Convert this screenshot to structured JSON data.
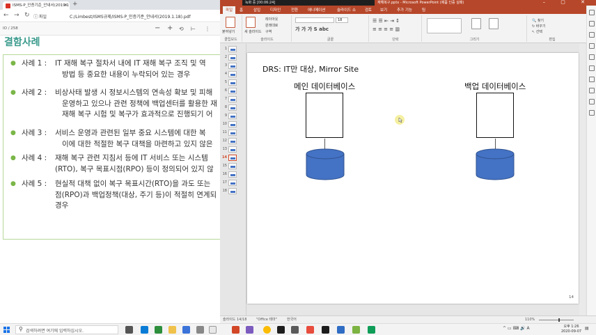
{
  "pdf_viewer": {
    "tab_title": "ISMS-P_인증기준_안내서(2019.1",
    "url": "C:/Limbest/ISMS규제/ISMS-P_인증기준_안내서(2019.1.18).pdf",
    "file_label": "파일",
    "page_counter": "IO  / 258",
    "heading": "결함사례",
    "cases": [
      {
        "label": "사례 1 :",
        "line1": "IT 재해 복구 절차서 내에 IT 재해 복구 조직 및 역",
        "line2": "방법 등 중요한 내용이 누락되어 있는 경우"
      },
      {
        "label": "사례 2 :",
        "line1": "비상사태 발생 시 정보시스템의 연속성 확보 및 피해",
        "line2": "운영하고 있으나 관련 정책에 백업센터를 활용한 재",
        "line3": "재해 복구 시험 및 복구가 효과적으로 진행되기 어"
      },
      {
        "label": "사례 3 :",
        "line1": "서비스 운영과 관련된 일부 중요 시스템에 대한 복",
        "line2": "이에 대한 적절한 복구 대책을 마련하고 있지 않은"
      },
      {
        "label": "사례 4 :",
        "line1": "재해 복구 관련 지침서 등에 IT 서비스 또는 시스템",
        "line2": "(RTO), 복구 목표시점(RPO) 등이 정의되어 있지 않"
      },
      {
        "label": "사례 5 :",
        "line1": "현실적 대책 없이 복구 목표시간(RTO)을 과도 또는",
        "line2": "점(RPO)과 백업정책(대상, 주기 등)이 적절히 연계되",
        "line3": "경우"
      }
    ]
  },
  "powerpoint": {
    "recording_text": "녹화 중 [00:06:24]",
    "window_title": "재해복구.pptx - Microsoft PowerPoint (제품 인증 실패)",
    "ribbon_tabs": [
      "파일",
      "홈",
      "삽입",
      "디자인",
      "전환",
      "애니메이션",
      "슬라이드 쇼",
      "검토",
      "보기",
      "추가 기능",
      "팀"
    ],
    "ribbon_groups": [
      "클립보드",
      "슬라이드",
      "글꼴",
      "단락",
      "그리기",
      "편집"
    ],
    "ribbon_buttons": {
      "paste": "붙여넣기",
      "new_slide": "새 슬라이드",
      "layout": "레이아웃",
      "reset": "원래대로",
      "section": "구역",
      "font_size": "18"
    },
    "slide_numbers": [
      "1",
      "2",
      "3",
      "4",
      "5",
      "6",
      "7",
      "8",
      "9",
      "10",
      "11",
      "12",
      "13",
      "14",
      "15",
      "16",
      "17",
      "18"
    ],
    "selected_slide": "14",
    "slide": {
      "title": "DRS: IT만 대상, Mirror Site",
      "main_db_label": "메인 데이터베이스",
      "backup_db_label": "백업 데이터베이스",
      "page_number": "14",
      "cylinder_color": "#4472c4"
    },
    "status": {
      "slide_info": "슬라이드 14/18",
      "theme": "\"Office 테마\"",
      "language": "한국어",
      "zoom": "110%"
    }
  },
  "taskbar": {
    "search_placeholder": "검색하려면 여기에 입력하십시오.",
    "time": "오후 1:26",
    "date": "2020-09-07"
  }
}
